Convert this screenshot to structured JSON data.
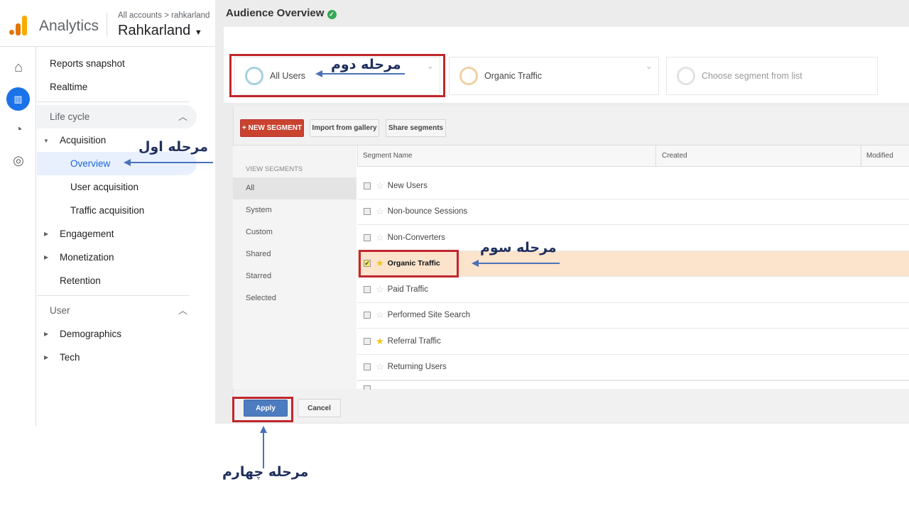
{
  "header": {
    "app_name": "Analytics",
    "breadcrumb": "All accounts > rahkarland",
    "property": "Rahkarland"
  },
  "sidebar": {
    "top_items": [
      "Reports snapshot",
      "Realtime"
    ],
    "lifecycle": {
      "label": "Life cycle",
      "acquisition": "Acquisition",
      "sub": [
        "Overview",
        "User acquisition",
        "Traffic acquisition"
      ],
      "others": [
        "Engagement",
        "Monetization",
        "Retention"
      ]
    },
    "user": {
      "label": "User",
      "items": [
        "Demographics",
        "Tech"
      ]
    }
  },
  "main": {
    "title": "Audience Overview",
    "segments": [
      "All Users",
      "Organic Traffic",
      "Choose segment from list"
    ],
    "toolbar": {
      "new_segment": "+ NEW SEGMENT",
      "import": "Import from gallery",
      "share": "Share segments"
    },
    "view_segments": {
      "heading": "VIEW SEGMENTS",
      "items": [
        "All",
        "System",
        "Custom",
        "Shared",
        "Starred",
        "Selected"
      ]
    },
    "table": {
      "headers": [
        "Segment Name",
        "Created",
        "Modified"
      ],
      "rows": [
        {
          "name": "New Users",
          "checked": false,
          "starred": false
        },
        {
          "name": "Non-bounce Sessions",
          "checked": false,
          "starred": false
        },
        {
          "name": "Non-Converters",
          "checked": false,
          "starred": false
        },
        {
          "name": "Organic Traffic",
          "checked": true,
          "starred": true
        },
        {
          "name": "Paid Traffic",
          "checked": false,
          "starred": false
        },
        {
          "name": "Performed Site Search",
          "checked": false,
          "starred": false
        },
        {
          "name": "Referral Traffic",
          "checked": false,
          "starred": true
        },
        {
          "name": "Returning Users",
          "checked": false,
          "starred": false
        }
      ]
    },
    "apply": "Apply",
    "cancel": "Cancel"
  },
  "annotations": {
    "step1": "مرحله اول",
    "step2": "مرحله دوم",
    "step3": "مرحله سوم",
    "step4": "مرحله چهارم"
  },
  "colors": {
    "accent": "#1a73e8",
    "highlight_red": "#c0272d",
    "new_segment": "#c9432f",
    "apply": "#4d7bbf",
    "selected_row": "#fbe3cc"
  }
}
